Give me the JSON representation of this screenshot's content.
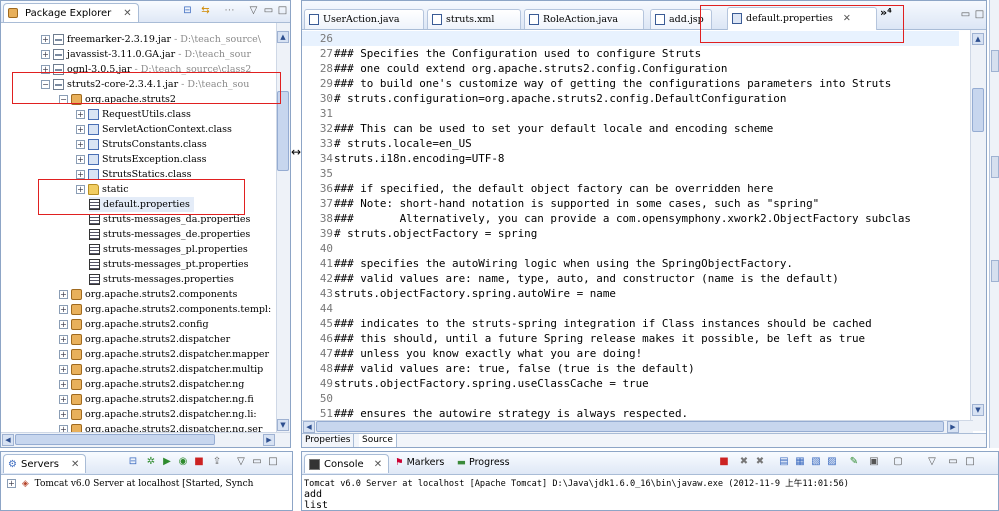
{
  "package_explorer": {
    "title": "Package Explorer",
    "items": [
      {
        "label": "freemarker-2.3.19.jar",
        "path": " - D:\\teach_source\\"
      },
      {
        "label": "javassist-3.11.0.GA.jar",
        "path": " - D:\\teach_sour"
      },
      {
        "label": "ognl-3.0.5.jar",
        "path": " - D:\\teach_source\\class2"
      },
      {
        "label": "struts2-core-2.3.4.1.jar",
        "path": " - D:\\teach_sou"
      },
      {
        "label": "org.apache.struts2"
      },
      {
        "label": "RequestUtils.class"
      },
      {
        "label": "ServletActionContext.class"
      },
      {
        "label": "StrutsConstants.class"
      },
      {
        "label": "StrutsException.class"
      },
      {
        "label": "StrutsStatics.class"
      },
      {
        "label": "static"
      },
      {
        "label": "default.properties"
      },
      {
        "label": "struts-messages_da.properties"
      },
      {
        "label": "struts-messages_de.properties"
      },
      {
        "label": "struts-messages_pl.properties"
      },
      {
        "label": "struts-messages_pt.properties"
      },
      {
        "label": "struts-messages.properties"
      },
      {
        "label": "org.apache.struts2.components"
      },
      {
        "label": "org.apache.struts2.components.templ:"
      },
      {
        "label": "org.apache.struts2.config"
      },
      {
        "label": "org.apache.struts2.dispatcher"
      },
      {
        "label": "org.apache.struts2.dispatcher.mapper"
      },
      {
        "label": "org.apache.struts2.dispatcher.multip"
      },
      {
        "label": "org.apache.struts2.dispatcher.ng"
      },
      {
        "label": "org.apache.struts2.dispatcher.ng.fi"
      },
      {
        "label": "org.apache.struts2.dispatcher.ng.li:"
      },
      {
        "label": "org.apache.struts2.dispatcher.ng.ser"
      }
    ]
  },
  "editor": {
    "tabs": [
      {
        "label": "UserAction.java"
      },
      {
        "label": "struts.xml"
      },
      {
        "label": "RoleAction.java"
      },
      {
        "label": "add.jsp"
      },
      {
        "label": "default.properties"
      }
    ],
    "overflow_label": "»⁴",
    "lines": [
      {
        "n": "26",
        "t": ""
      },
      {
        "n": "27",
        "t": "### Specifies the Configuration used to configure Struts"
      },
      {
        "n": "28",
        "t": "### one could extend org.apache.struts2.config.Configuration"
      },
      {
        "n": "29",
        "t": "### to build one's customize way of getting the configurations parameters into Struts"
      },
      {
        "n": "30",
        "t": "# struts.configuration=org.apache.struts2.config.DefaultConfiguration"
      },
      {
        "n": "31",
        "t": ""
      },
      {
        "n": "32",
        "t": "### This can be used to set your default locale and encoding scheme"
      },
      {
        "n": "33",
        "t": "# struts.locale=en_US"
      },
      {
        "n": "34",
        "t": "struts.i18n.encoding=UTF-8"
      },
      {
        "n": "35",
        "t": ""
      },
      {
        "n": "36",
        "t": "### if specified, the default object factory can be overridden here"
      },
      {
        "n": "37",
        "t": "### Note: short-hand notation is supported in some cases, such as \"spring\""
      },
      {
        "n": "38",
        "t": "###       Alternatively, you can provide a com.opensymphony.xwork2.ObjectFactory subclas"
      },
      {
        "n": "39",
        "t": "# struts.objectFactory = spring"
      },
      {
        "n": "40",
        "t": ""
      },
      {
        "n": "41",
        "t": "### specifies the autoWiring logic when using the SpringObjectFactory."
      },
      {
        "n": "42",
        "t": "### valid values are: name, type, auto, and constructor (name is the default)"
      },
      {
        "n": "43",
        "t": "struts.objectFactory.spring.autoWire = name"
      },
      {
        "n": "44",
        "t": ""
      },
      {
        "n": "45",
        "t": "### indicates to the struts-spring integration if Class instances should be cached"
      },
      {
        "n": "46",
        "t": "### this should, until a future Spring release makes it possible, be left as true"
      },
      {
        "n": "47",
        "t": "### unless you know exactly what you are doing!"
      },
      {
        "n": "48",
        "t": "### valid values are: true, false (true is the default)"
      },
      {
        "n": "49",
        "t": "struts.objectFactory.spring.useClassCache = true"
      },
      {
        "n": "50",
        "t": ""
      },
      {
        "n": "51",
        "t": "### ensures the autowire strategy is always respected."
      }
    ],
    "bottom_tabs": [
      {
        "label": "Properties"
      },
      {
        "label": "Source"
      }
    ]
  },
  "servers": {
    "title": "Servers",
    "server_line": "Tomcat v6.0 Server at localhost  [Started, Synch"
  },
  "console": {
    "tabs": [
      {
        "label": "Console"
      },
      {
        "label": "Markers"
      },
      {
        "label": "Progress"
      }
    ],
    "header": "Tomcat v6.0 Server at localhost [Apache Tomcat] D:\\Java\\jdk1.6.0_16\\bin\\javaw.exe (2012-11-9 上午11:01:56)",
    "output": [
      "add",
      "list"
    ]
  },
  "colors": {
    "highlight_box": "#e02020",
    "view_border": "#8da5c6"
  }
}
